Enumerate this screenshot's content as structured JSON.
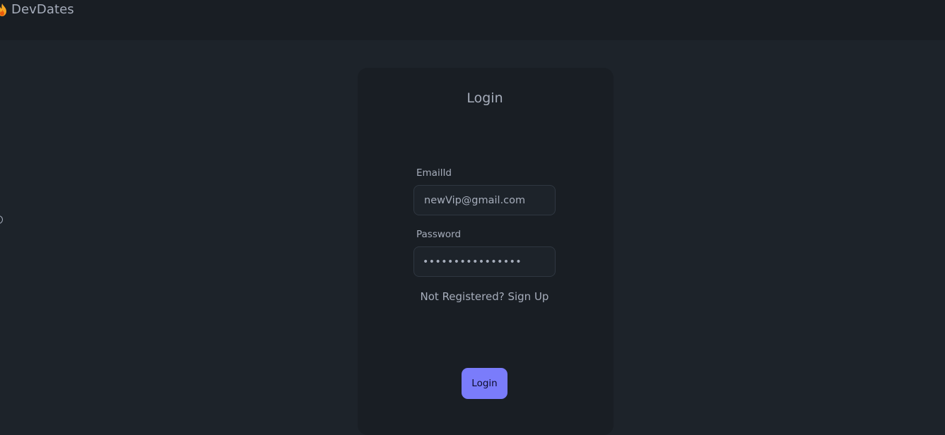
{
  "app": {
    "brand_icon": "flame-icon",
    "brand_name": "DevDates"
  },
  "form": {
    "title": "Login",
    "email_label": "EmailId",
    "email_value": "newVip@gmail.com",
    "password_label": "Password",
    "password_value": "••••••••••••••••",
    "signup_link": "Not Registered? Sign Up",
    "submit_label": "Login"
  },
  "colors": {
    "page_background": "#1d232a",
    "navbar_background": "#191e24",
    "card_background": "#191e24",
    "primary_button": "#7a7cfb",
    "text": "#a6adbb"
  }
}
